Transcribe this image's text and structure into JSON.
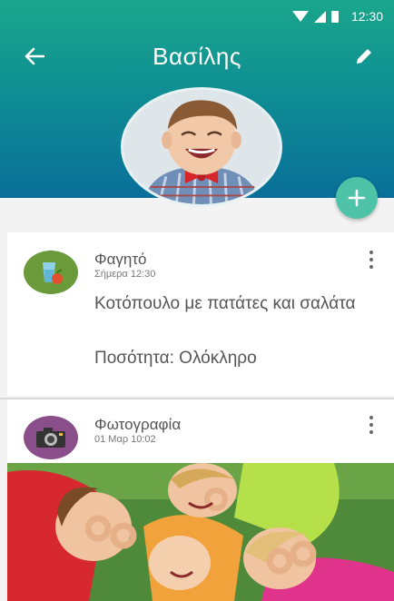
{
  "status_bar": {
    "time": "12:30"
  },
  "toolbar": {
    "title": "Βασίλης"
  },
  "feed": {
    "items": [
      {
        "type": "Φαγητό",
        "timestamp": "Σήμερα 12:30",
        "description": "Κοτόπουλο με πατάτες και σαλάτα",
        "quantity": "Ποσότητα: Ολόκληρο"
      },
      {
        "type": "Φωτογραφία",
        "timestamp": "01 Μαρ 10:02"
      }
    ]
  },
  "colors": {
    "header_top": "#1aa68c",
    "header_bottom": "#0a6f99",
    "fab": "#4fc3a8",
    "food_icon_bg": "#6a9a3a",
    "photo_icon_bg": "#8a4f8b"
  },
  "icons": {
    "back": "arrow-left-icon",
    "edit": "pencil-icon",
    "add": "plus-icon",
    "more": "more-vertical-icon",
    "food": "food-icon",
    "camera": "camera-icon"
  }
}
